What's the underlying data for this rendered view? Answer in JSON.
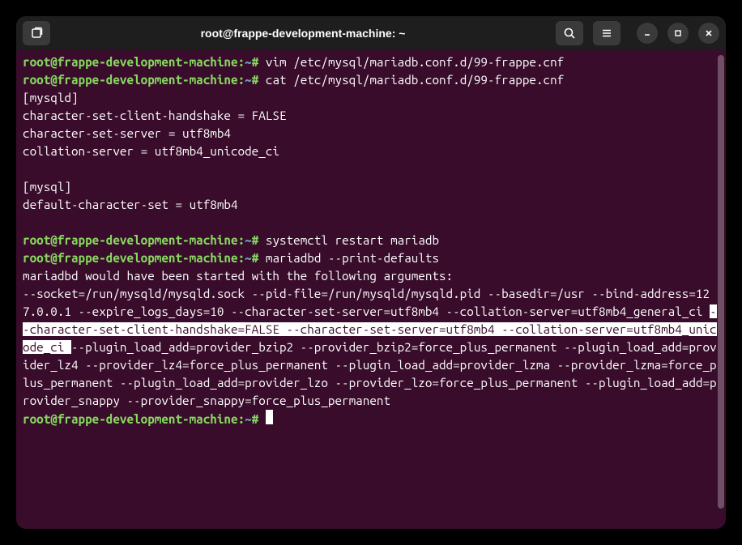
{
  "titlebar": {
    "title": "root@frappe-development-machine: ~"
  },
  "prompt": {
    "userhost": "root@frappe-development-machine",
    "sep": ":",
    "path": "~",
    "marker": "#"
  },
  "lines": {
    "cmd1": "vim /etc/mysql/mariadb.conf.d/99-frappe.cnf",
    "cmd2": "cat /etc/mysql/mariadb.conf.d/99-frappe.cnf",
    "out1": "[mysqld]",
    "out2": "character-set-client-handshake = FALSE",
    "out3": "character-set-server = utf8mb4",
    "out4": "collation-server = utf8mb4_unicode_ci",
    "out5": "",
    "out6": "[mysql]",
    "out7": "default-character-set = utf8mb4",
    "out8": "",
    "cmd3": "systemctl restart mariadb",
    "cmd4": "mariadbd --print-defaults",
    "out9": "mariadbd would have been started with the following arguments:",
    "defaults_pre": "--socket=/run/mysqld/mysqld.sock --pid-file=/run/mysqld/mysqld.pid --basedir=/usr --bind-address=127.0.0.1 --expire_logs_days=10 --character-set-server=utf8mb4 --collation-server=utf8mb4_general_ci ",
    "defaults_sel": "--character-set-client-handshake=FALSE --character-set-server=utf8mb4 --collation-server=utf8mb4_unicode_ci ",
    "defaults_post": "--plugin_load_add=provider_bzip2 --provider_bzip2=force_plus_permanent --plugin_load_add=provider_lz4 --provider_lz4=force_plus_permanent --plugin_load_add=provider_lzma --provider_lzma=force_plus_permanent --plugin_load_add=provider_lzo --provider_lzo=force_plus_permanent --plugin_load_add=provider_snappy --provider_snappy=force_plus_permanent"
  }
}
